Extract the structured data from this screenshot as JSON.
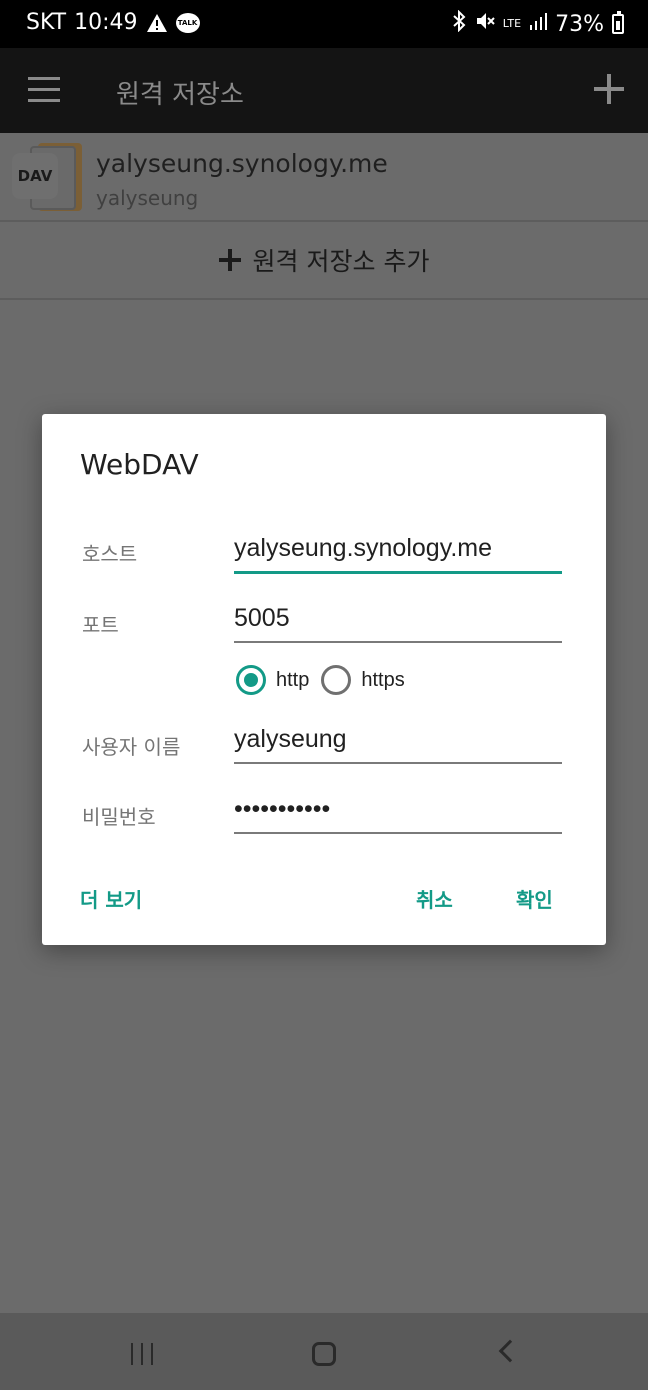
{
  "status_bar": {
    "carrier": "SKT",
    "time": "10:49",
    "talk_badge": "TALK",
    "network": "LTE",
    "battery": "73%",
    "icons": [
      "warning-icon",
      "kakaotalk-icon",
      "bluetooth-icon",
      "mute-icon",
      "lte-icon",
      "signal-icon",
      "battery-icon"
    ]
  },
  "toolbar": {
    "title": "원격 저장소",
    "menu_icon": "hamburger-menu-icon",
    "add_icon": "plus-icon"
  },
  "storage_list": {
    "items": [
      {
        "icon_label": "DAV",
        "name": "yalyseung.synology.me",
        "user": "yalyseung"
      }
    ],
    "add_label": "원격 저장소 추가"
  },
  "dialog": {
    "title": "WebDAV",
    "host_label": "호스트",
    "host_value": "yalyseung.synology.me",
    "port_label": "포트",
    "port_value": "5005",
    "protocol_options": [
      "http",
      "https"
    ],
    "protocol_selected": "http",
    "username_label": "사용자 이름",
    "username_value": "yalyseung",
    "password_label": "비밀번호",
    "password_value": "•••••••••••",
    "more_label": "더 보기",
    "cancel_label": "취소",
    "confirm_label": "확인",
    "accent_color": "#139a87"
  },
  "nav_bar": {
    "icons": [
      "recents-icon",
      "home-icon",
      "back-icon"
    ]
  }
}
